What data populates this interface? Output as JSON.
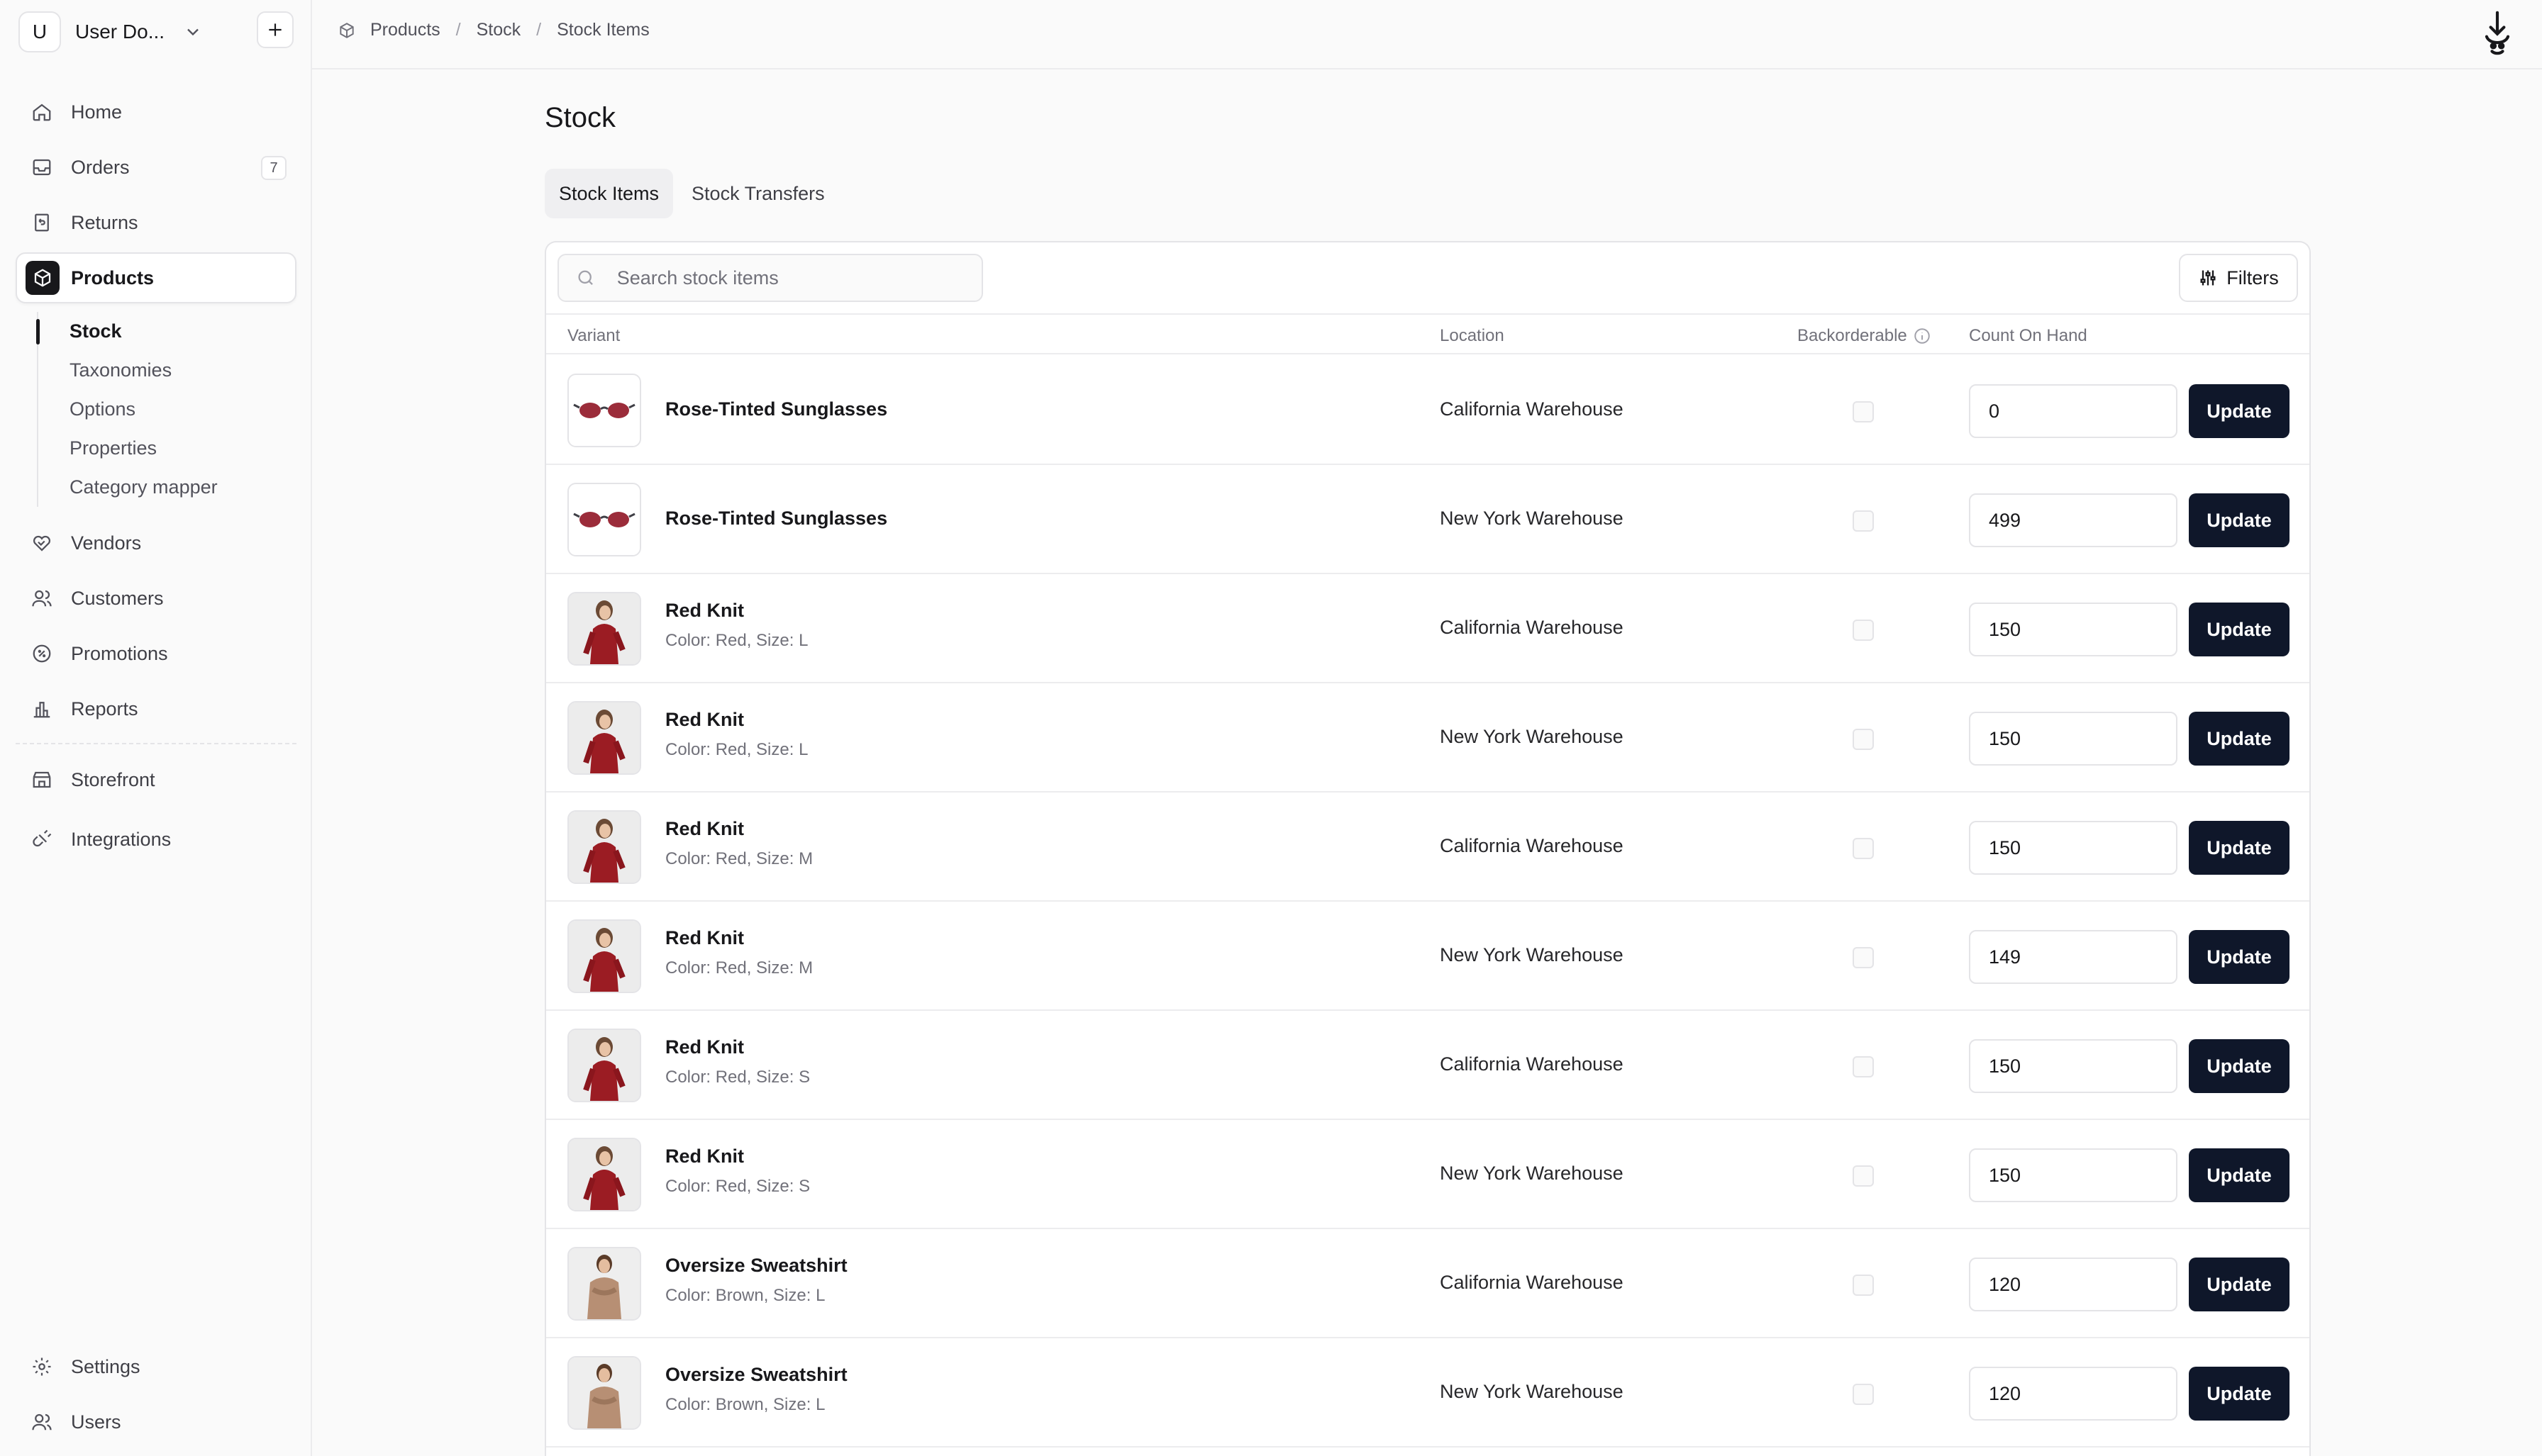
{
  "store": {
    "avatar_letter": "U",
    "name": "User Do..."
  },
  "nav": {
    "home": "Home",
    "orders": "Orders",
    "orders_badge": "7",
    "returns": "Returns",
    "products": "Products",
    "vendors": "Vendors",
    "customers": "Customers",
    "promotions": "Promotions",
    "reports": "Reports",
    "storefront": "Storefront",
    "integrations": "Integrations",
    "settings": "Settings",
    "users": "Users"
  },
  "subnav": [
    "Stock",
    "Taxonomies",
    "Options",
    "Properties",
    "Category mapper"
  ],
  "breadcrumb": [
    "Products",
    "Stock",
    "Stock Items"
  ],
  "page_title": "Stock",
  "tabs": [
    "Stock Items",
    "Stock Transfers"
  ],
  "search": {
    "placeholder": "Search stock items"
  },
  "filters_label": "Filters",
  "columns": {
    "variant": "Variant",
    "location": "Location",
    "backorderable": "Backorderable",
    "count": "Count On Hand"
  },
  "update_label": "Update",
  "rows": [
    {
      "name": "Rose-Tinted Sunglasses",
      "options": "",
      "location": "California Warehouse",
      "backorderable": false,
      "count": "0",
      "image": "sunglasses-icon"
    },
    {
      "name": "Rose-Tinted Sunglasses",
      "options": "",
      "location": "New York Warehouse",
      "backorderable": false,
      "count": "499",
      "image": "sunglasses-icon"
    },
    {
      "name": "Red Knit",
      "options": "Color: Red, Size: L",
      "location": "California Warehouse",
      "backorderable": false,
      "count": "150",
      "image": "red-knit-photo"
    },
    {
      "name": "Red Knit",
      "options": "Color: Red, Size: L",
      "location": "New York Warehouse",
      "backorderable": false,
      "count": "150",
      "image": "red-knit-photo"
    },
    {
      "name": "Red Knit",
      "options": "Color: Red, Size: M",
      "location": "California Warehouse",
      "backorderable": false,
      "count": "150",
      "image": "red-knit-photo"
    },
    {
      "name": "Red Knit",
      "options": "Color: Red, Size: M",
      "location": "New York Warehouse",
      "backorderable": false,
      "count": "149",
      "image": "red-knit-photo"
    },
    {
      "name": "Red Knit",
      "options": "Color: Red, Size: S",
      "location": "California Warehouse",
      "backorderable": false,
      "count": "150",
      "image": "red-knit-photo"
    },
    {
      "name": "Red Knit",
      "options": "Color: Red, Size: S",
      "location": "New York Warehouse",
      "backorderable": false,
      "count": "150",
      "image": "red-knit-photo"
    },
    {
      "name": "Oversize Sweatshirt",
      "options": "Color: Brown, Size: L",
      "location": "California Warehouse",
      "backorderable": false,
      "count": "120",
      "image": "sweatshirt-photo"
    },
    {
      "name": "Oversize Sweatshirt",
      "options": "Color: Brown, Size: L",
      "location": "New York Warehouse",
      "backorderable": false,
      "count": "120",
      "image": "sweatshirt-photo"
    }
  ],
  "colors": {
    "primary_button": "#0f172a",
    "border": "#e4e4e7",
    "muted_text": "#71717a"
  }
}
